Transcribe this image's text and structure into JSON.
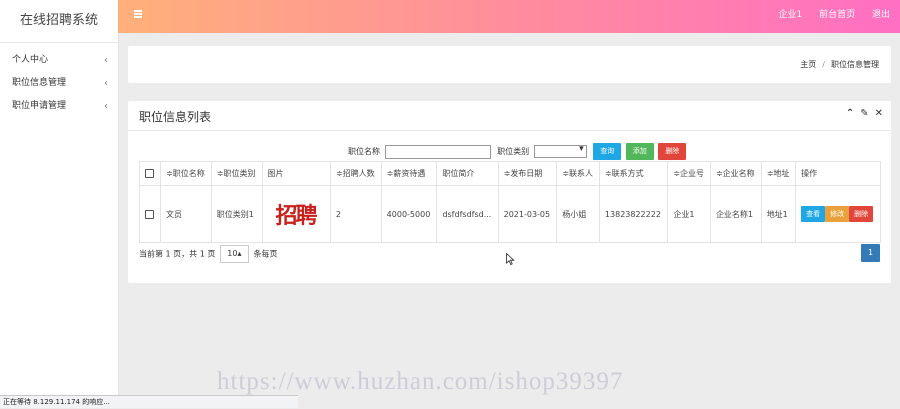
{
  "brand": "在线招聘系统",
  "sidebar": {
    "items": [
      {
        "label": "个人中心",
        "chev": "‹"
      },
      {
        "label": "职位信息管理",
        "chev": "‹"
      },
      {
        "label": "职位申请管理",
        "chev": "‹"
      }
    ]
  },
  "topbar": {
    "links": [
      "企业1",
      "前台首页",
      "退出"
    ]
  },
  "breadcrumb": {
    "home": "主页",
    "sep": "/",
    "current": "职位信息管理"
  },
  "panel": {
    "title": "职位信息列表"
  },
  "search": {
    "name_label": "职位名称",
    "name_value": "",
    "category_label": "职位类别",
    "category_value": "",
    "query_label": "查询",
    "add_label": "添加",
    "delete_label": "删除"
  },
  "table": {
    "headers": [
      "",
      "≑职位名称",
      "≑职位类别",
      "图片",
      "≑招聘人数",
      "≑薪资待遇",
      "职位简介",
      "≑发布日期",
      "≑联系人",
      "≑联系方式",
      "≑企业号",
      "≑企业名称",
      "≑地址",
      "操作"
    ],
    "rows": [
      {
        "name": "文员",
        "category": "职位类别1",
        "image_text": "招聘",
        "count": "2",
        "salary": "4000-5000",
        "intro": "dsfdfsdfsd...",
        "date": "2021-03-05",
        "contact": "杨小姐",
        "phone": "13823822222",
        "company_no": "企业1",
        "company_name": "企业名称1",
        "address": "地址1",
        "ops": {
          "view": "查看",
          "edit": "修改",
          "delete": "删除"
        }
      }
    ]
  },
  "pagination": {
    "prefix": "当前第 1 页，共 1 页",
    "page_size": "10▴",
    "suffix": "条每页",
    "page": "1"
  },
  "status_bar": "正在等待 8.129.11.174 的响应...",
  "watermark": "https://www.huzhan.com/ishop39397"
}
